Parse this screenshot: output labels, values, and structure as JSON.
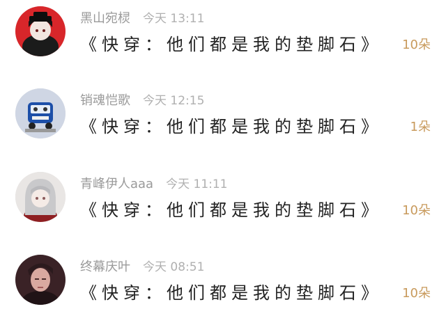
{
  "comments": [
    {
      "username": "黑山宛棂",
      "time": "今天 13:11",
      "text": "《快穿：他们都是我的垫脚石》",
      "count": "10朵",
      "avatar_icon": "dark-anime-boy-avatar"
    },
    {
      "username": "销魂恺歌",
      "time": "今天 12:15",
      "text": "《快穿：他们都是我的垫脚石》",
      "count": "1朵",
      "avatar_icon": "toy-bus-avatar"
    },
    {
      "username": "青峰伊人aaa",
      "time": "今天 11:11",
      "text": "《快穿：他们都是我的垫脚石》",
      "count": "10朵",
      "avatar_icon": "silver-hair-girl-avatar"
    },
    {
      "username": "终幕庆叶",
      "time": "今天 08:51",
      "text": "《快穿：他们都是我的垫脚石》",
      "count": "10朵",
      "avatar_icon": "man-portrait-avatar"
    }
  ],
  "colors": {
    "count": "#c89a5c",
    "meta": "#9a9a9a",
    "text": "#222222"
  }
}
